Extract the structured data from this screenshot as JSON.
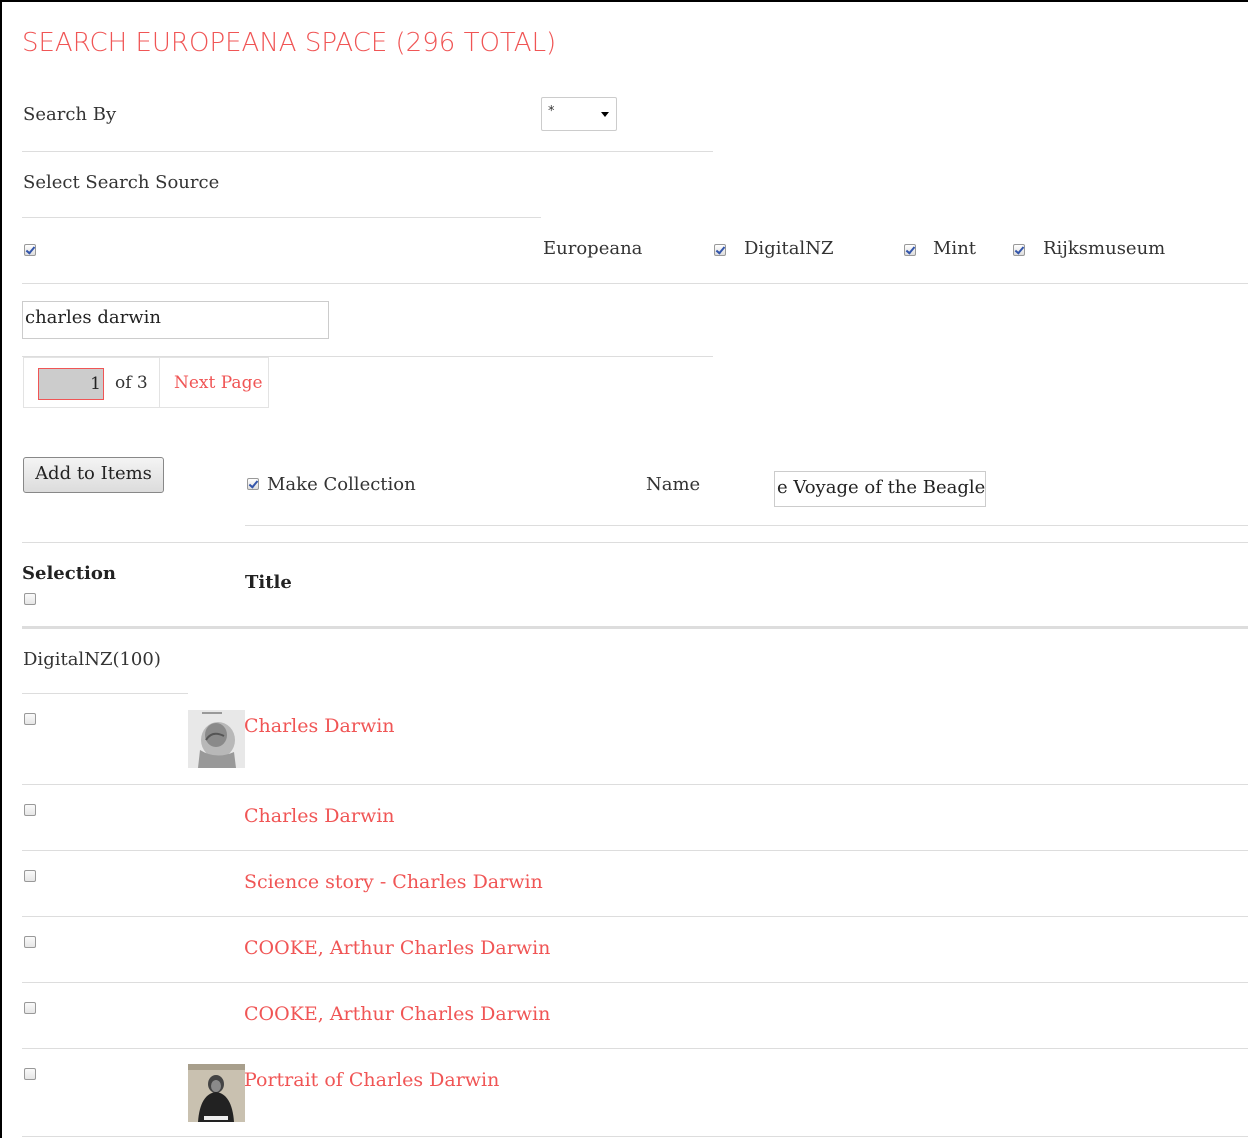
{
  "page_title": "SEARCH EUROPEANA SPACE (296 TOTAL)",
  "search_by": {
    "label": "Search By",
    "selected": "*"
  },
  "source": {
    "label": "Select Search Source",
    "options": [
      {
        "label": "Europeana",
        "checked": true
      },
      {
        "label": "DigitalNZ",
        "checked": true
      },
      {
        "label": "Mint",
        "checked": true
      },
      {
        "label": "Rijksmuseum",
        "checked": true
      }
    ]
  },
  "query": "charles darwin",
  "pager": {
    "current": "1",
    "of_label": "of 3",
    "next_label": "Next Page"
  },
  "actions": {
    "add_label": "Add to Items",
    "make_collection_label": "Make Collection",
    "make_collection_checked": true,
    "name_label": "Name",
    "name_value": "e Voyage of the Beagle"
  },
  "table": {
    "selection_header": "Selection",
    "title_header": "Title",
    "group_label": "DigitalNZ(100)",
    "rows": [
      {
        "title": "Charles Darwin",
        "thumb": "darwin-portrait-sketch"
      },
      {
        "title": "Charles Darwin",
        "thumb": ""
      },
      {
        "title": "Science story - Charles Darwin",
        "thumb": ""
      },
      {
        "title": "COOKE, Arthur Charles Darwin",
        "thumb": ""
      },
      {
        "title": "COOKE, Arthur Charles Darwin",
        "thumb": ""
      },
      {
        "title": "Portrait of Charles Darwin",
        "thumb": "darwin-photo-portrait"
      }
    ]
  },
  "colors": {
    "accent": "#f05555",
    "text": "#333333",
    "rule": "#dddddd"
  }
}
